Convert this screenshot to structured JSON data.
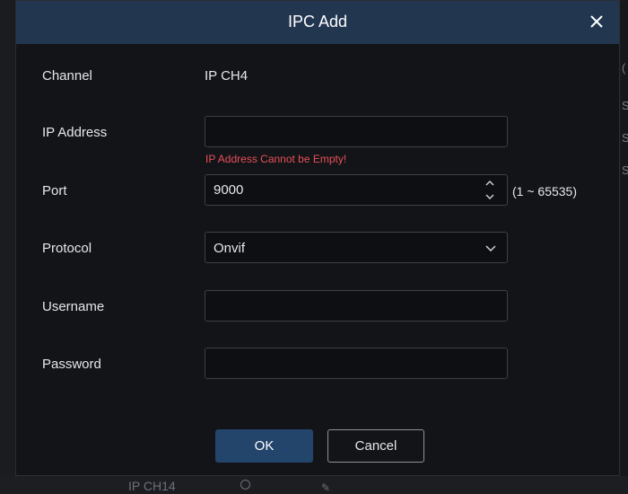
{
  "background": {
    "right_chars": [
      "(",
      "S",
      "S",
      "S"
    ],
    "bottom_row_text": "IP CH14"
  },
  "dialog": {
    "title": "IPC Add",
    "close_icon": "close-icon",
    "fields": {
      "channel": {
        "label": "Channel",
        "value": "IP CH4"
      },
      "ip_address": {
        "label": "IP Address",
        "value": "",
        "error": "IP Address Cannot be Empty!"
      },
      "port": {
        "label": "Port",
        "value": "9000",
        "range": "(1 ~ 65535)"
      },
      "protocol": {
        "label": "Protocol",
        "value": "Onvif"
      },
      "username": {
        "label": "Username",
        "value": ""
      },
      "password": {
        "label": "Password",
        "value": ""
      }
    },
    "buttons": {
      "ok": "OK",
      "cancel": "Cancel"
    }
  },
  "colors": {
    "header": "#223650",
    "error": "#e8505b",
    "primary_button": "#23456b"
  }
}
